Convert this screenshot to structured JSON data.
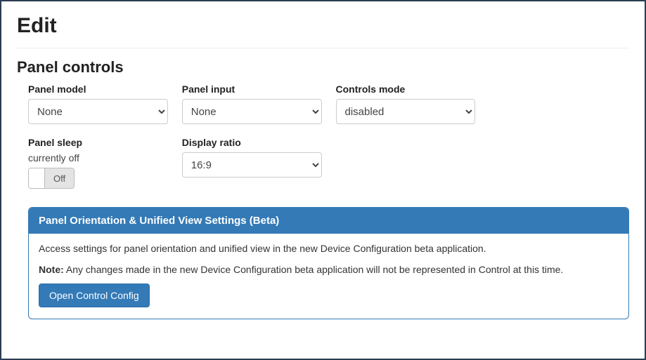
{
  "page": {
    "title": "Edit",
    "section": "Panel controls"
  },
  "fields": {
    "panel_model": {
      "label": "Panel model",
      "value": "None"
    },
    "panel_input": {
      "label": "Panel input",
      "value": "None"
    },
    "controls_mode": {
      "label": "Controls mode",
      "value": "disabled"
    },
    "panel_sleep": {
      "label": "Panel sleep",
      "status": "currently off",
      "toggle": "Off"
    },
    "display_ratio": {
      "label": "Display ratio",
      "value": "16:9"
    }
  },
  "beta": {
    "title": "Panel Orientation & Unified View Settings (Beta)",
    "desc": "Access settings for panel orientation and unified view in the new Device Configuration beta application.",
    "note_label": "Note:",
    "note_text": " Any changes made in the new Device Configuration beta application will not be represented in Control at this time.",
    "button": "Open Control Config"
  }
}
